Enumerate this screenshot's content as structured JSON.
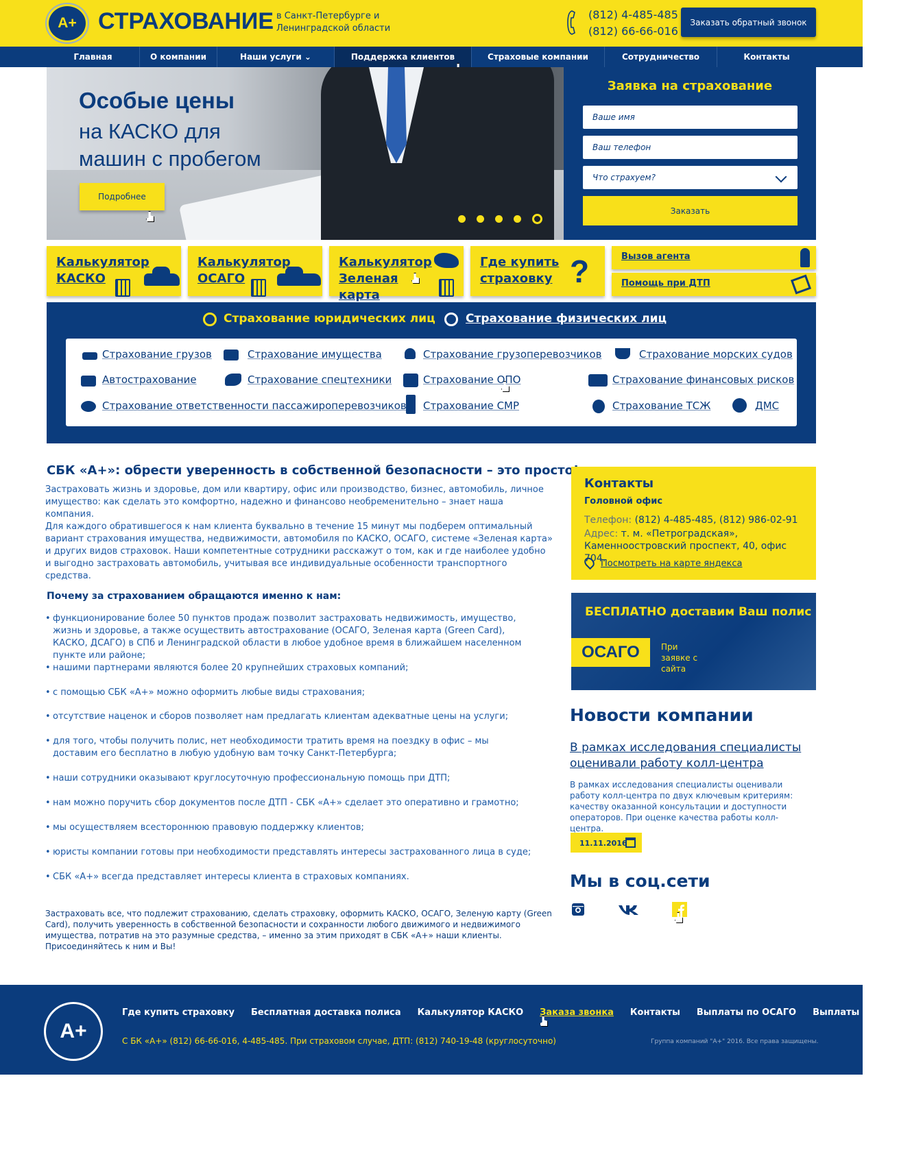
{
  "header": {
    "logo_text": "A+",
    "brand": "СТРАХОВАНИЕ",
    "region": "в Санкт-Петербурге и Ленинградской области",
    "phone1": "(812) 4-485-485",
    "phone2": "(812) 66-66-016",
    "callback_label": "Заказать обратный звонок"
  },
  "nav": {
    "items": [
      {
        "label": "Главная"
      },
      {
        "label": "О компании"
      },
      {
        "label": "Наши услуги ⌄"
      },
      {
        "label": "Поддержка клиентов"
      },
      {
        "label": "Страховые компании"
      },
      {
        "label": "Сотрудничество"
      },
      {
        "label": "Контакты"
      }
    ]
  },
  "hero": {
    "title1": "Особые цены",
    "title2": "на КАСКО для машин с пробегом",
    "button": "Подробнее"
  },
  "form": {
    "title": "Заявка на страхование",
    "name_placeholder": "Ваше имя",
    "phone_placeholder": "Ваш телефон",
    "what_placeholder": "Что страхуем?",
    "submit": "Заказать"
  },
  "tiles": {
    "kasko": "Калькулятор КАСКО",
    "osago": "Калькулятор ОСАГО",
    "green": "Калькулятор Зеленая карта",
    "where": "Где купить страховку",
    "where_mark": "?",
    "agent": "Вызов агента",
    "dtp": "Помощь при ДТП"
  },
  "services": {
    "tab_legal": "Страхование юридических лиц",
    "tab_personal": "Страхование физических лиц",
    "items": [
      "Страхование грузов",
      "Страхование имущества",
      "Страхование грузоперевозчиков",
      "Страхование морских судов",
      "Автострахование",
      "Страхование спецтехники",
      "Страхование ОПО",
      "Страхование финансовых рисков",
      "Страхование ответственности пассажироперевозчиков",
      "Страхование СМР",
      "Страхование ТСЖ",
      "ДМС"
    ]
  },
  "main": {
    "title": "СБК «А+»: обрести уверенность в собственной безопасности – это просто!",
    "p1": "Застраховать жизнь и здоровье, дом или квартиру, офис или производство, бизнес, автомобиль, личное имущество: как сделать это комфортно, надежно и финансово необременительно – знает наша компания.",
    "p2": "Для каждого обратившегося к нам клиента буквально в течение 15 минут мы подберем оптимальный вариант страхования имущества, недвижимости, автомобиля по КАСКО, ОСАГО, системе «Зеленая карта» и других видов страховок. Наши компетентные сотрудники расскажут о том, как и где наиболее удобно и выгодно застраховать автомобиль, учитывая все индивидуальные особенности транспортного средства.",
    "why_title": "Почему за страхованием обращаются именно к нам:",
    "reasons": [
      "функционирование более 50 пунктов продаж позволит застраховать недвижимость, имущество, жизнь и здоровье, а также осуществить автострахование (ОСАГО, Зеленая карта (Green Card), КАСКО, ДСАГО) в СПб и Ленинградской области в любое удобное время в ближайшем населенном пункте или районе;",
      "нашими партнерами являются более 20 крупнейших страховых компаний;",
      "с помощью СБК «А+» можно оформить любые виды страхования;",
      "отсутствие наценок и сборов позволяет нам предлагать клиентам адекватные цены на услуги;",
      "для того, чтобы получить полис, нет необходимости тратить время на поездку в офис – мы доставим его бесплатно в любую удобную вам точку Санкт-Петербурга;",
      "наши сотрудники оказывают круглосуточную профессиональную помощь при ДТП;",
      "нам можно поручить сбор документов после ДТП - СБК «А+» сделает это оперативно и грамотно;",
      "мы осуществляем всестороннюю правовую поддержку клиентов;",
      "юристы компании готовы при необходимости представлять интересы застрахованного лица в суде;",
      "СБК «А+» всегда представляет интересы клиента в страховых компаниях."
    ],
    "outro": "Застраховать все, что подлежит страхованию, сделать страховку, оформить КАСКО, ОСАГО, Зеленую карту (Green Card), получить уверенность в собственной безопасности и сохранности любого движимого и недвижимого имущества, потратив на это разумные средства, – именно за этим приходят в СБК «А+» наши клиенты. Присоединяйтесь к ним и Вы!"
  },
  "contacts": {
    "title": "Контакты",
    "office": "Головной офис",
    "phone_key": "Телефон:",
    "phone_val": "(812) 4-485-485, (812) 986-02-91",
    "addr_key": "Адрес:",
    "addr_val": "т. м.  «Петроградская», Каменноостровский проспект, 40, офис 704.",
    "map_link": "Посмотреть на карте яндекса"
  },
  "promo": {
    "title": "БЕСПЛАТНО доставим Ваш полис",
    "badge": "ОСАГО",
    "note": "При заявке с сайта"
  },
  "news": {
    "heading": "Новости компании",
    "link": "В рамках исследования специалисты оценивали работу колл-центра",
    "text": "В рамках исследования специалисты оценивали работу колл-центра по двух ключевым критериям: качеству оказанной консультации и доступности операторов.  При оценке качества работы колл-центра.",
    "date": "11.11.2016"
  },
  "social": {
    "heading": "Мы в соц.сети"
  },
  "footer": {
    "logo_text": "A+",
    "links": [
      "Где купить страховку",
      "Бесплатная доставка полиса",
      "Калькулятор КАСКО",
      "Заказа звонка",
      "Контакты",
      "Выплаты по ОСАГО",
      "Выплаты по КАСКО"
    ],
    "phones_line": "С БК «А+»  (812) 66-66-016, 4-485-485. При страховом случае, ДТП:  (812) 740-19-48  (круглосуточно)",
    "copyright": "Группа компаний \"А+\" 2016. Все права защищены."
  },
  "colors": {
    "primary": "#0b3c7d",
    "accent": "#f8e01a"
  }
}
